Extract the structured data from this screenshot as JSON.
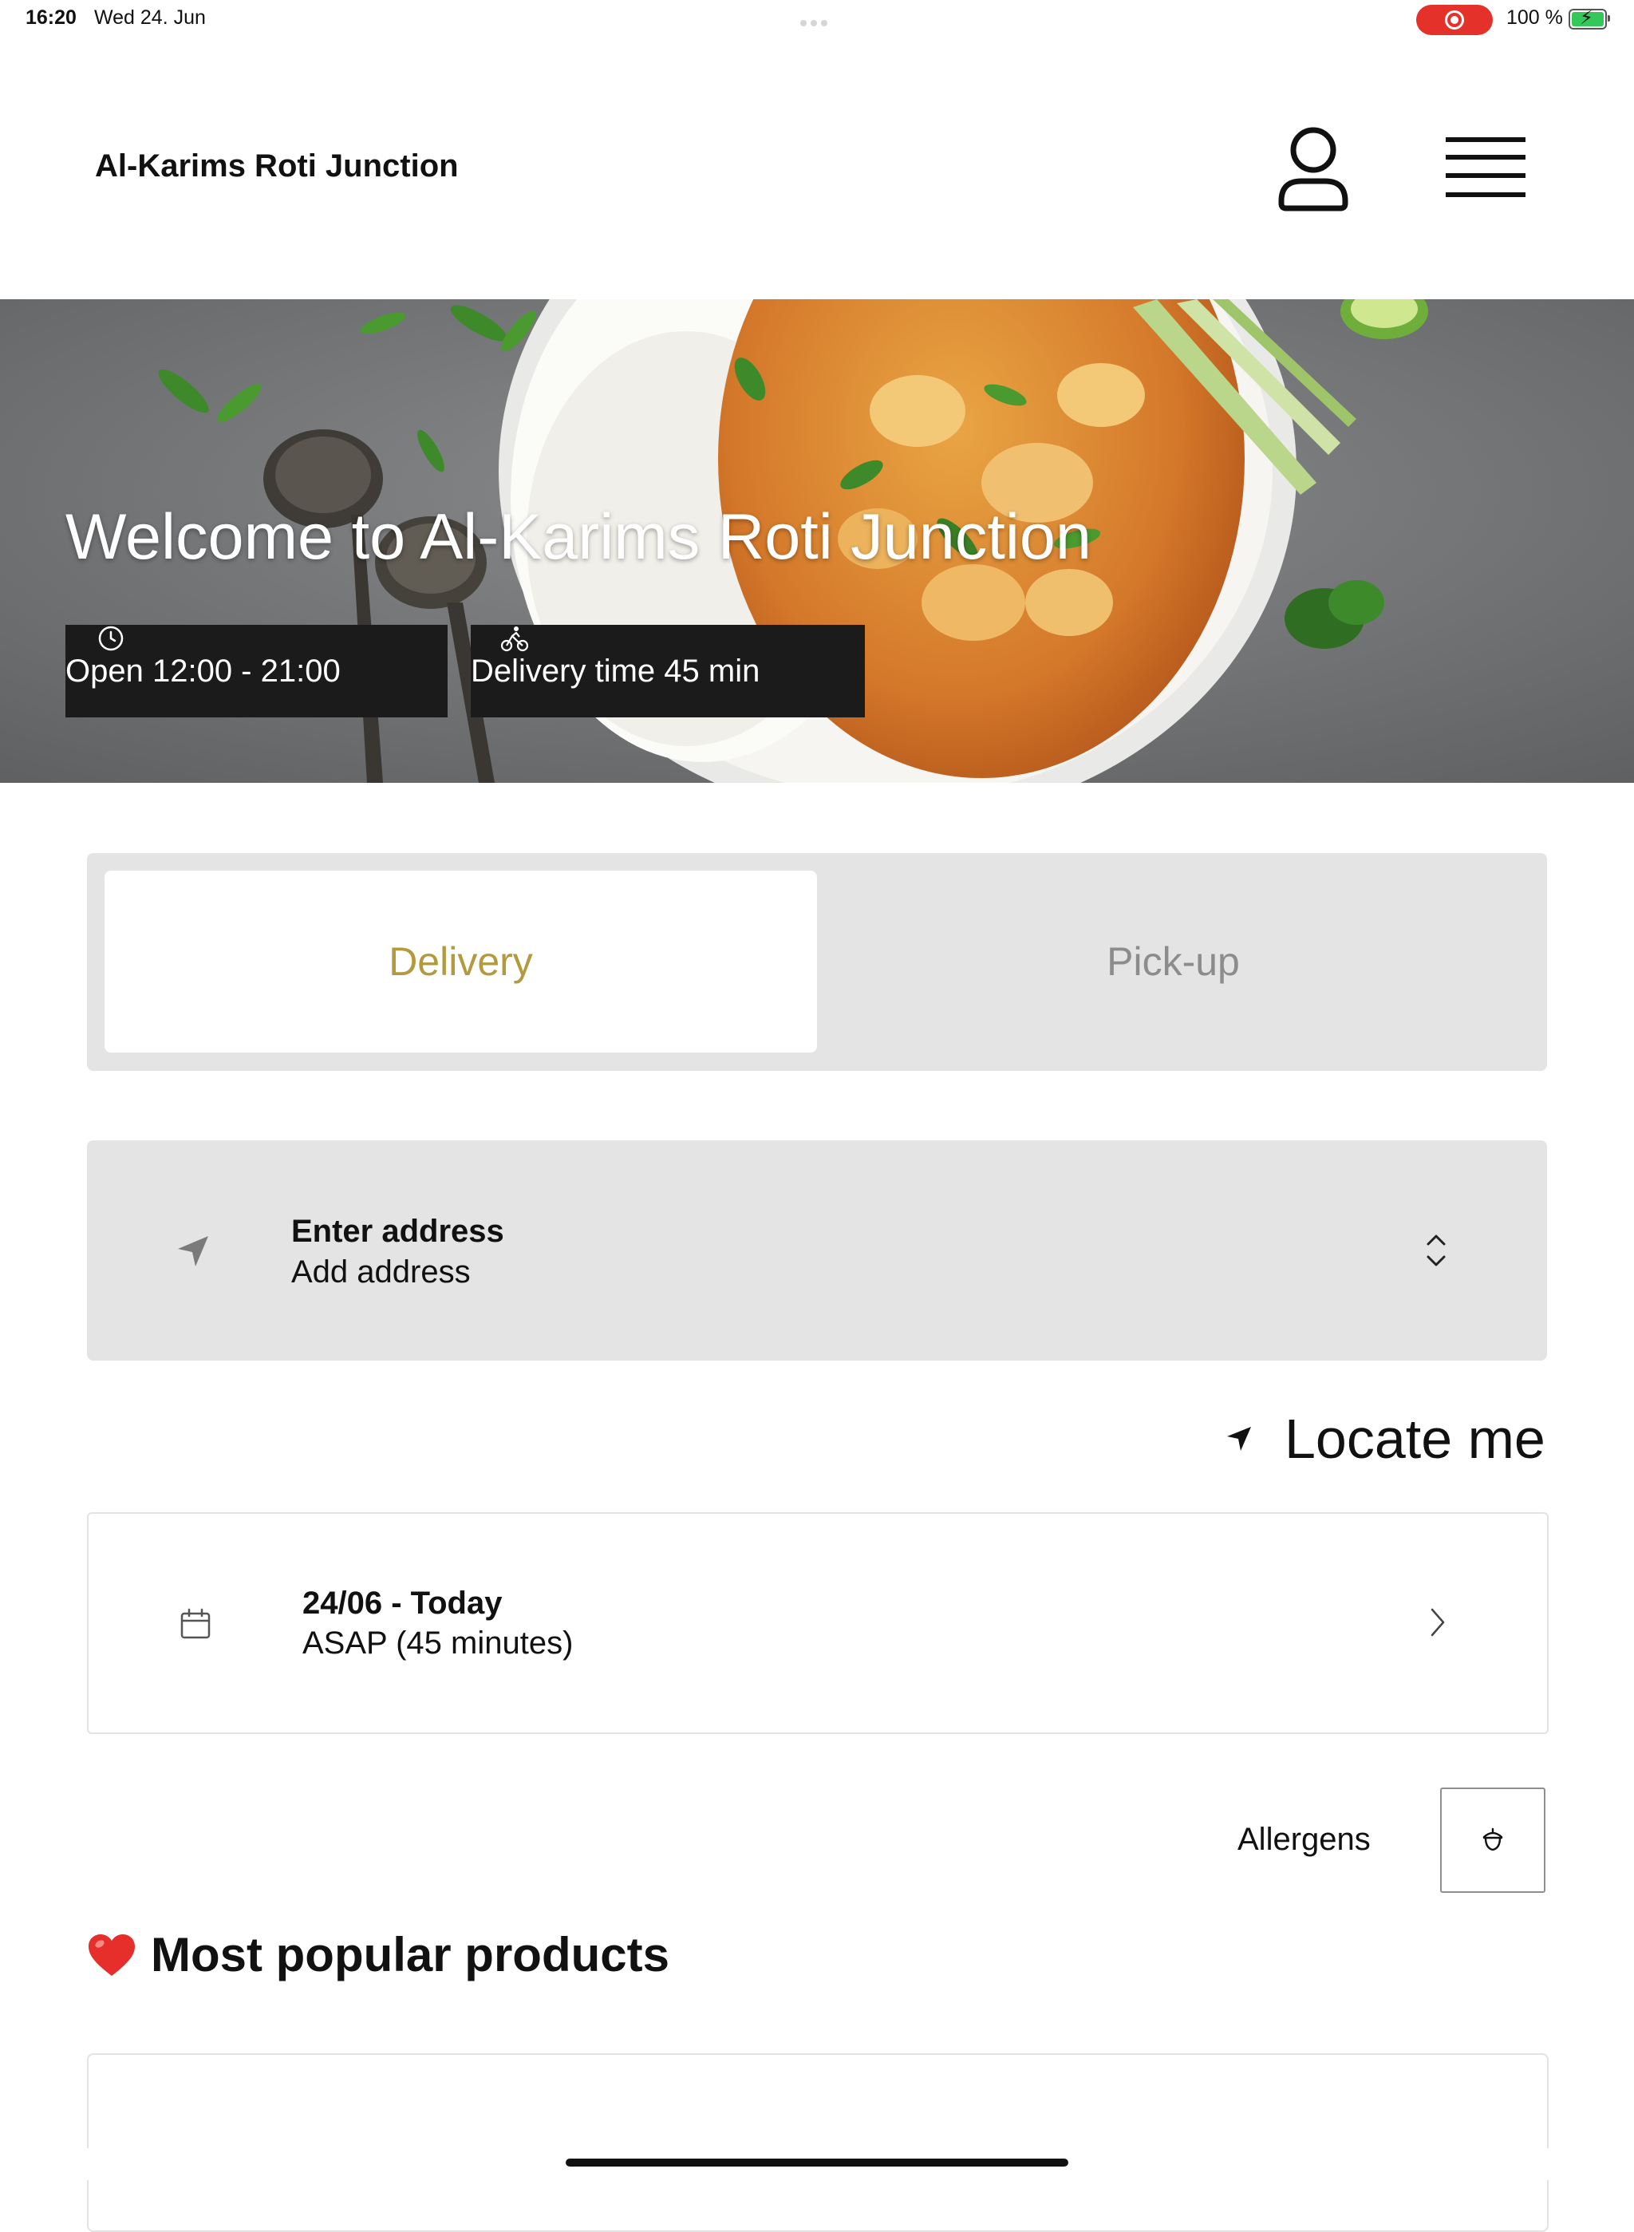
{
  "status_bar": {
    "time": "16:20",
    "date": "Wed 24. Jun",
    "battery": "100 %"
  },
  "header": {
    "brand": "Al-Karims Roti Junction"
  },
  "hero": {
    "title": "Welcome to Al-Karims Roti Junction",
    "open_hours": "Open 12:00 - 21:00",
    "delivery_time": "Delivery time 45 min"
  },
  "mode_toggle": {
    "delivery_label": "Delivery",
    "pickup_label": "Pick-up",
    "selected": "Delivery"
  },
  "address": {
    "title": "Enter address",
    "subtitle": "Add address"
  },
  "locate_me": "Locate me",
  "schedule": {
    "date": "24/06 - Today",
    "time": "ASAP (45 minutes)"
  },
  "allergens_label": "Allergens",
  "popular": {
    "heading": "Most popular products"
  },
  "colors": {
    "accent": "#b39a3e",
    "chip_bg": "#1b1b1b",
    "panel_bg": "#e4e4e4",
    "record_red": "#e4322b",
    "battery_green": "#34c759"
  }
}
